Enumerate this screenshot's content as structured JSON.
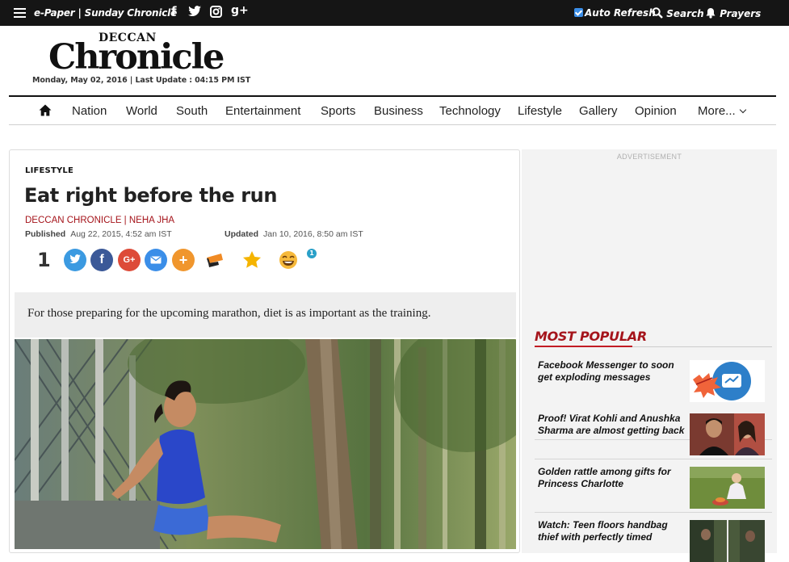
{
  "topbar": {
    "epaper_label": "e-Paper | Sunday Chronicle",
    "social": [
      {
        "name": "facebook-icon",
        "glyph": "f"
      },
      {
        "name": "twitter-icon",
        "glyph": "t"
      },
      {
        "name": "instagram-icon",
        "glyph": "◙"
      },
      {
        "name": "googleplus-icon",
        "glyph": "g+"
      }
    ],
    "auto_refresh_label": "Auto Refresh",
    "search_label": "Search",
    "prayers_label": "Prayers"
  },
  "masthead": {
    "logo_top": "DECCAN",
    "logo_main": "Chronicle",
    "dateline": "Monday, May 02, 2016 | Last Update : 04:15 PM IST"
  },
  "nav": {
    "items": [
      "Nation",
      "World",
      "South",
      "Entertainment",
      "Sports",
      "Business",
      "Technology",
      "Lifestyle",
      "Gallery",
      "Opinion",
      "More..."
    ]
  },
  "article": {
    "kicker": "LIFESTYLE",
    "title": "Eat right before the run",
    "byline": "DECCAN CHRONICLE | NEHA JHA",
    "published_label": "Published",
    "published_value": "Aug 22, 2015, 4:52 am IST",
    "updated_label": "Updated",
    "updated_value": "Jan 10, 2016, 8:50 am IST",
    "share_count": "1",
    "share_buttons": [
      {
        "name": "twitter-share-icon",
        "glyph": "t",
        "color": "#3b9ae1"
      },
      {
        "name": "facebook-share-icon",
        "glyph": "f",
        "color": "#3b5998"
      },
      {
        "name": "googleplus-share-icon",
        "glyph": "G+",
        "color": "#dd4b39"
      },
      {
        "name": "email-share-icon",
        "glyph": "✉",
        "color": "#3b8ee8"
      },
      {
        "name": "more-share-icon",
        "glyph": "+",
        "color": "#f0962d"
      }
    ],
    "reaction_badge": "1",
    "summary": "For those preparing for the upcoming marathon, diet is as important as the training."
  },
  "sidebar": {
    "ad_label": "ADVERTISEMENT",
    "popular_title": "MOST POPULAR",
    "popular_items": [
      {
        "title": "Facebook Messenger to soon get exploding messages",
        "thumb": "boom-thumbnail"
      },
      {
        "title": "Proof! Virat Kohli and Anushka Sharma are almost getting back",
        "thumb": "couple-thumbnail"
      },
      {
        "title": "Golden rattle among gifts for Princess Charlotte",
        "thumb": "child-thumbnail"
      },
      {
        "title": "Watch: Teen floors handbag thief with perfectly timed",
        "thumb": "street-thumbnail"
      }
    ]
  },
  "colors": {
    "accent_red": "#a5141b",
    "topbar_bg": "#151515"
  }
}
